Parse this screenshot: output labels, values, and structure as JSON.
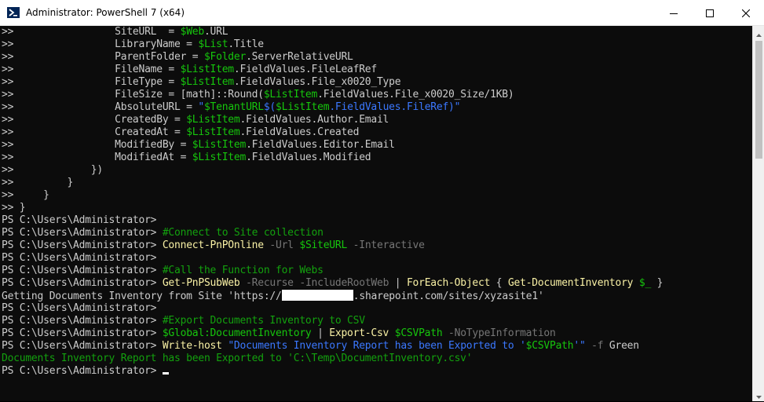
{
  "window": {
    "title": "Administrator: PowerShell 7 (x64)"
  },
  "icons": {
    "app": "powershell-icon",
    "minimize": "minimize-icon",
    "maximize": "maximize-icon",
    "close": "close-icon"
  },
  "colors": {
    "background": "#0c0c0c",
    "variable": "#16c60c",
    "string": "#3b78ff",
    "command": "#f9f1a5",
    "parameter": "#767676",
    "comment": "#13a10e"
  },
  "terminal": {
    "lines": [
      [
        {
          "t": "text",
          "v": ">>                 SiteURL  = "
        },
        {
          "t": "var",
          "v": "$Web"
        },
        {
          "t": "text",
          "v": ".URL"
        }
      ],
      [
        {
          "t": "text",
          "v": ">>                 LibraryName = "
        },
        {
          "t": "var",
          "v": "$List"
        },
        {
          "t": "text",
          "v": ".Title"
        }
      ],
      [
        {
          "t": "text",
          "v": ">>                 ParentFolder = "
        },
        {
          "t": "var",
          "v": "$Folder"
        },
        {
          "t": "text",
          "v": ".ServerRelativeURL"
        }
      ],
      [
        {
          "t": "text",
          "v": ">>                 FileName = "
        },
        {
          "t": "var",
          "v": "$ListItem"
        },
        {
          "t": "text",
          "v": ".FieldValues.FileLeafRef"
        }
      ],
      [
        {
          "t": "text",
          "v": ">>                 FileType = "
        },
        {
          "t": "var",
          "v": "$ListItem"
        },
        {
          "t": "text",
          "v": ".FieldValues.File_x0020_Type"
        }
      ],
      [
        {
          "t": "text",
          "v": ">>                 FileSize = [math]::Round("
        },
        {
          "t": "var",
          "v": "$ListItem"
        },
        {
          "t": "text",
          "v": ".FieldValues.File_x0020_Size/1KB)"
        }
      ],
      [
        {
          "t": "text",
          "v": ">>                 AbsoluteURL = "
        },
        {
          "t": "str",
          "v": "\""
        },
        {
          "t": "var",
          "v": "$TenantURL"
        },
        {
          "t": "str",
          "v": "$("
        },
        {
          "t": "var",
          "v": "$ListItem"
        },
        {
          "t": "str",
          "v": ".FieldValues.FileRef)\""
        }
      ],
      [
        {
          "t": "text",
          "v": ">>                 CreatedBy = "
        },
        {
          "t": "var",
          "v": "$ListItem"
        },
        {
          "t": "text",
          "v": ".FieldValues.Author.Email"
        }
      ],
      [
        {
          "t": "text",
          "v": ">>                 CreatedAt = "
        },
        {
          "t": "var",
          "v": "$ListItem"
        },
        {
          "t": "text",
          "v": ".FieldValues.Created"
        }
      ],
      [
        {
          "t": "text",
          "v": ">>                 ModifiedBy = "
        },
        {
          "t": "var",
          "v": "$ListItem"
        },
        {
          "t": "text",
          "v": ".FieldValues.Editor.Email"
        }
      ],
      [
        {
          "t": "text",
          "v": ">>                 ModifiedAt = "
        },
        {
          "t": "var",
          "v": "$ListItem"
        },
        {
          "t": "text",
          "v": ".FieldValues.Modified"
        }
      ],
      [
        {
          "t": "text",
          "v": ">>             })"
        }
      ],
      [
        {
          "t": "text",
          "v": ">>         }"
        }
      ],
      [
        {
          "t": "text",
          "v": ">>     }"
        }
      ],
      [
        {
          "t": "text",
          "v": ">> }"
        }
      ],
      [
        {
          "t": "prompt",
          "v": "PS C:\\Users\\Administrator>"
        }
      ],
      [
        {
          "t": "prompt",
          "v": "PS C:\\Users\\Administrator> "
        },
        {
          "t": "comment",
          "v": "#Connect to Site collection"
        }
      ],
      [
        {
          "t": "prompt",
          "v": "PS C:\\Users\\Administrator> "
        },
        {
          "t": "cmd",
          "v": "Connect-PnPOnline"
        },
        {
          "t": "text",
          "v": " "
        },
        {
          "t": "param",
          "v": "-Url"
        },
        {
          "t": "text",
          "v": " "
        },
        {
          "t": "var",
          "v": "$SiteURL"
        },
        {
          "t": "text",
          "v": " "
        },
        {
          "t": "param",
          "v": "-Interactive"
        }
      ],
      [
        {
          "t": "prompt",
          "v": "PS C:\\Users\\Administrator>"
        }
      ],
      [
        {
          "t": "prompt",
          "v": "PS C:\\Users\\Administrator> "
        },
        {
          "t": "comment",
          "v": "#Call the Function for Webs"
        }
      ],
      [
        {
          "t": "prompt",
          "v": "PS C:\\Users\\Administrator> "
        },
        {
          "t": "cmd",
          "v": "Get-PnPSubWeb"
        },
        {
          "t": "text",
          "v": " "
        },
        {
          "t": "param",
          "v": "-Recurse"
        },
        {
          "t": "text",
          "v": " "
        },
        {
          "t": "param",
          "v": "-IncludeRootWeb"
        },
        {
          "t": "text",
          "v": " | "
        },
        {
          "t": "cmd",
          "v": "ForEach-Object"
        },
        {
          "t": "text",
          "v": " { "
        },
        {
          "t": "cmd",
          "v": "Get-DocumentInventory"
        },
        {
          "t": "text",
          "v": " "
        },
        {
          "t": "var",
          "v": "$_"
        },
        {
          "t": "text",
          "v": " }"
        }
      ],
      [
        {
          "t": "out",
          "v": "Getting Documents Inventory from Site 'https://"
        },
        {
          "t": "redact",
          "v": "            "
        },
        {
          "t": "out",
          "v": ".sharepoint.com/sites/xyzasite1'"
        }
      ],
      [
        {
          "t": "prompt",
          "v": "PS C:\\Users\\Administrator>"
        }
      ],
      [
        {
          "t": "prompt",
          "v": "PS C:\\Users\\Administrator> "
        },
        {
          "t": "comment",
          "v": "#Export Documents Inventory to CSV"
        }
      ],
      [
        {
          "t": "prompt",
          "v": "PS C:\\Users\\Administrator> "
        },
        {
          "t": "var",
          "v": "$Global:DocumentInventory"
        },
        {
          "t": "text",
          "v": " | "
        },
        {
          "t": "cmd",
          "v": "Export-Csv"
        },
        {
          "t": "text",
          "v": " "
        },
        {
          "t": "var",
          "v": "$CSVPath"
        },
        {
          "t": "text",
          "v": " "
        },
        {
          "t": "param",
          "v": "-NoTypeInformation"
        }
      ],
      [
        {
          "t": "prompt",
          "v": "PS C:\\Users\\Administrator> "
        },
        {
          "t": "cmd",
          "v": "Write-host"
        },
        {
          "t": "text",
          "v": " "
        },
        {
          "t": "str",
          "v": "\"Documents Inventory Report has been Exported to '"
        },
        {
          "t": "var",
          "v": "$CSVPath"
        },
        {
          "t": "str",
          "v": "'\""
        },
        {
          "t": "text",
          "v": " "
        },
        {
          "t": "param",
          "v": "-f"
        },
        {
          "t": "text",
          "v": " Green"
        }
      ],
      [
        {
          "t": "green",
          "v": "Documents Inventory Report has been Exported to 'C:\\Temp\\DocumentInventory.csv'"
        }
      ],
      [
        {
          "t": "prompt",
          "v": "PS C:\\Users\\Administrator> "
        },
        {
          "t": "cursor",
          "v": ""
        }
      ]
    ]
  }
}
